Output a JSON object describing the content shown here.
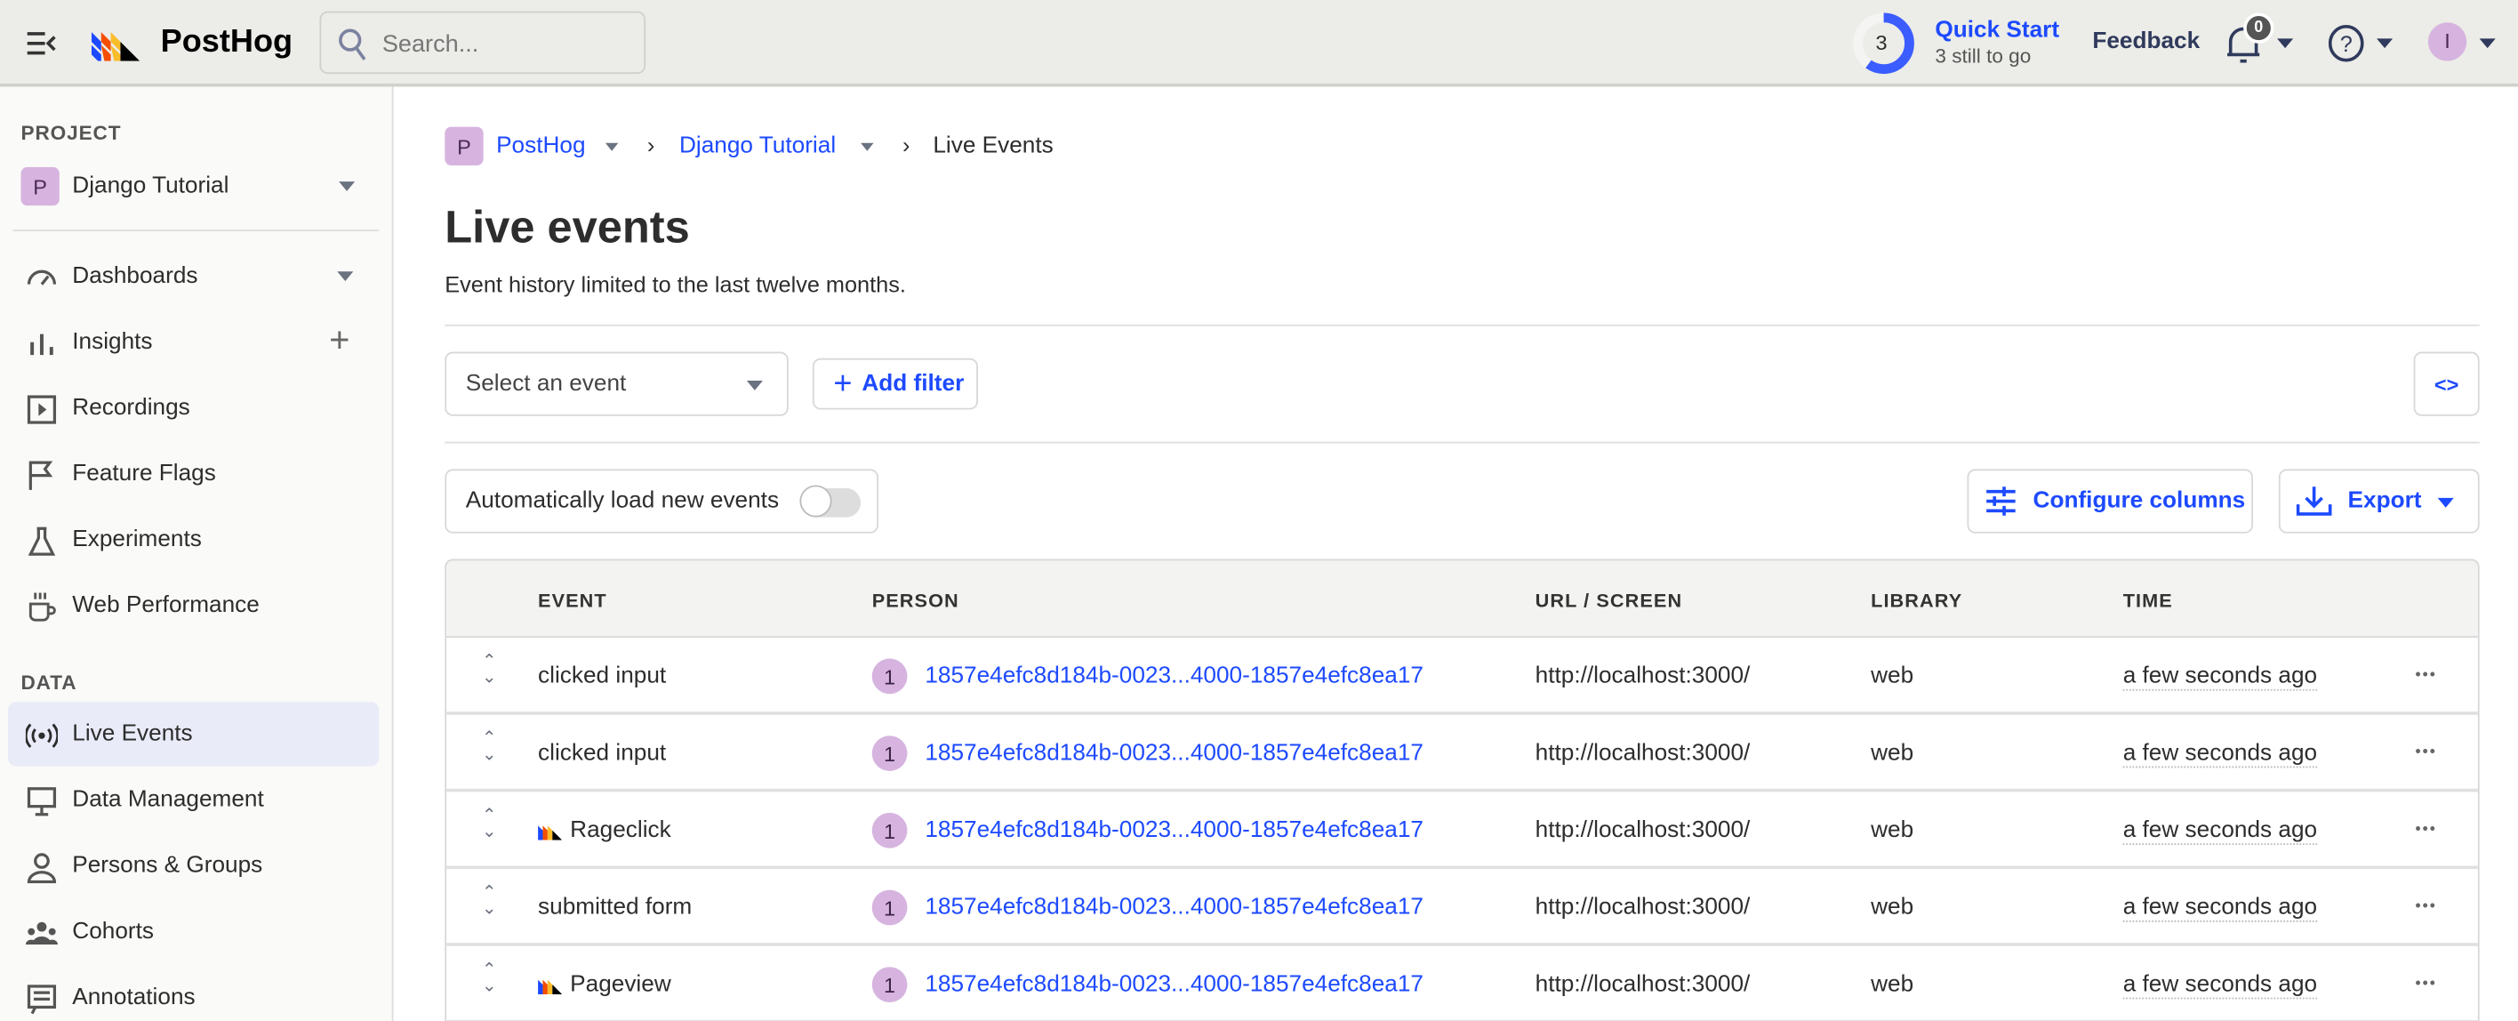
{
  "topbar": {
    "brand": "PostHog",
    "search_placeholder": "Search...",
    "quick_start": {
      "count": "3",
      "title": "Quick Start",
      "subtitle": "3 still to go",
      "progress": 0.6
    },
    "feedback": "Feedback",
    "notifications": "0",
    "user_initial": "I"
  },
  "sidebar": {
    "project_header": "PROJECT",
    "project_initial": "P",
    "project_name": "Django Tutorial",
    "data_header": "DATA",
    "items": [
      {
        "label": "Dashboards",
        "icon": "gauge-icon"
      },
      {
        "label": "Insights",
        "icon": "bar-chart-icon"
      },
      {
        "label": "Recordings",
        "icon": "play-icon"
      },
      {
        "label": "Feature Flags",
        "icon": "flag-icon"
      },
      {
        "label": "Experiments",
        "icon": "flask-icon"
      },
      {
        "label": "Web Performance",
        "icon": "coffee-icon"
      }
    ],
    "data_items": [
      {
        "label": "Live Events",
        "icon": "broadcast-icon"
      },
      {
        "label": "Data Management",
        "icon": "monitor-icon"
      },
      {
        "label": "Persons & Groups",
        "icon": "person-icon"
      },
      {
        "label": "Cohorts",
        "icon": "group-icon"
      },
      {
        "label": "Annotations",
        "icon": "annotation-icon"
      }
    ]
  },
  "breadcrumb": {
    "org_initial": "P",
    "org": "PostHog",
    "project": "Django Tutorial",
    "current": "Live Events"
  },
  "page": {
    "title": "Live events",
    "subtitle": "Event history limited to the last twelve months."
  },
  "filters": {
    "event_select": "Select an event",
    "add_filter": "Add filter",
    "auto_load": "Automatically load new events",
    "auto_load_on": false,
    "configure_columns": "Configure columns",
    "export": "Export"
  },
  "table": {
    "headers": [
      "EVENT",
      "PERSON",
      "URL / SCREEN",
      "LIBRARY",
      "TIME"
    ],
    "rows": [
      {
        "event": "clicked input",
        "autocapture": false,
        "person_initial": "1",
        "person": "1857e4efc8d184b-0023...4000-1857e4efc8ea17",
        "url": "http://localhost:3000/",
        "library": "web",
        "time": "a few seconds ago"
      },
      {
        "event": "clicked input",
        "autocapture": false,
        "person_initial": "1",
        "person": "1857e4efc8d184b-0023...4000-1857e4efc8ea17",
        "url": "http://localhost:3000/",
        "library": "web",
        "time": "a few seconds ago"
      },
      {
        "event": "Rageclick",
        "autocapture": true,
        "person_initial": "1",
        "person": "1857e4efc8d184b-0023...4000-1857e4efc8ea17",
        "url": "http://localhost:3000/",
        "library": "web",
        "time": "a few seconds ago"
      },
      {
        "event": "submitted form",
        "autocapture": false,
        "person_initial": "1",
        "person": "1857e4efc8d184b-0023...4000-1857e4efc8ea17",
        "url": "http://localhost:3000/",
        "library": "web",
        "time": "a few seconds ago"
      },
      {
        "event": "Pageview",
        "autocapture": true,
        "person_initial": "1",
        "person": "1857e4efc8d184b-0023...4000-1857e4efc8ea17",
        "url": "http://localhost:3000/",
        "library": "web",
        "time": "a few seconds ago"
      }
    ]
  }
}
